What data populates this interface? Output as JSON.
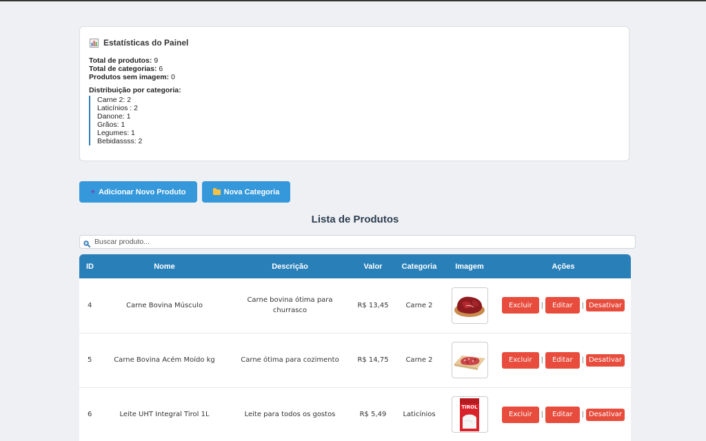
{
  "stats": {
    "title": "Estatísticas do Painel",
    "icon": "bar-chart-icon",
    "total_products_label": "Total de produtos:",
    "total_products_value": "9",
    "total_categories_label": "Total de categorias:",
    "total_categories_value": "6",
    "no_image_label": "Produtos sem imagem:",
    "no_image_value": "0",
    "distribution_title": "Distribuição por categoria:",
    "distribution": [
      "Carne 2: 2",
      "Laticínios : 2",
      "Danone: 1",
      "Grãos: 1",
      "Legumes: 1",
      "Bebidassss: 2"
    ]
  },
  "buttons": {
    "add_product": "Adicionar Novo Produto",
    "new_category": "Nova Categoria",
    "add_icon": "plus-icon",
    "category_icon": "folder-icon"
  },
  "list_title": "Lista de Produtos",
  "search": {
    "placeholder": "Buscar produto...",
    "value": "",
    "icon": "search-icon"
  },
  "table": {
    "headers": [
      "ID",
      "Nome",
      "Descrição",
      "Valor",
      "Categoria",
      "Imagem",
      "Ações"
    ],
    "rows": [
      {
        "id": "4",
        "name": "Carne Bovina Músculo",
        "description": "Carne bovina ótima para churrasco",
        "price": "R$ 13,45",
        "category": "Carne 2",
        "image": "beef-muscle-image"
      },
      {
        "id": "5",
        "name": "Carne Bovina Acém Moído kg",
        "description": "Carne ótima para cozimento",
        "price": "R$ 14,75",
        "category": "Carne 2",
        "image": "ground-beef-image"
      },
      {
        "id": "6",
        "name": "Leite UHT Integral Tirol 1L",
        "description": "Leite para todos os gostos",
        "price": "R$ 5,49",
        "category": "Laticínios",
        "image": "milk-carton-image"
      }
    ],
    "actions": {
      "delete": "Excluir",
      "edit": "Editar",
      "deactivate": "Desativar",
      "separator": "|"
    }
  },
  "colors": {
    "header_blue": "#2980b9",
    "button_blue": "#3498db",
    "action_red": "#e74c3c",
    "accent_line": "#2a7ab8"
  },
  "milk_brand": "TIROL"
}
